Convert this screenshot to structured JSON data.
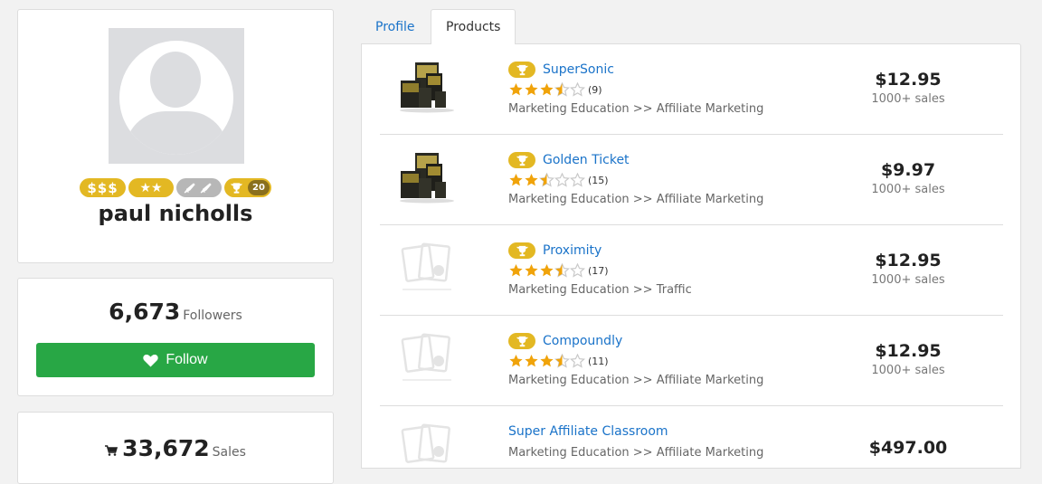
{
  "user": {
    "name": "paul nicholls",
    "badges": {
      "money": "$$$",
      "stars": "★★",
      "trophy_count": "20"
    }
  },
  "followers": {
    "count": "6,673",
    "label": "Followers",
    "button_label": "Follow"
  },
  "sales": {
    "count": "33,672",
    "label": "Sales"
  },
  "tabs": [
    {
      "label": "Profile"
    },
    {
      "label": "Products"
    }
  ],
  "products": [
    {
      "title": "SuperSonic",
      "rating": 3.5,
      "reviews": "(9)",
      "category": "Marketing Education >> Affiliate Marketing",
      "price": "$12.95",
      "sales": "1000+ sales",
      "badge": true,
      "image": "product-box"
    },
    {
      "title": "Golden Ticket",
      "rating": 2.5,
      "reviews": "(15)",
      "category": "Marketing Education >> Affiliate Marketing",
      "price": "$9.97",
      "sales": "1000+ sales",
      "badge": true,
      "image": "product-box"
    },
    {
      "title": "Proximity",
      "rating": 3.5,
      "reviews": "(17)",
      "category": "Marketing Education >> Traffic",
      "price": "$12.95",
      "sales": "1000+ sales",
      "badge": true,
      "image": "placeholder"
    },
    {
      "title": "Compoundly",
      "rating": 3.5,
      "reviews": "(11)",
      "category": "Marketing Education >> Affiliate Marketing",
      "price": "$12.95",
      "sales": "1000+ sales",
      "badge": true,
      "image": "placeholder"
    },
    {
      "title": "Super Affiliate Classroom",
      "rating": null,
      "reviews": "",
      "category": "Marketing Education >> Affiliate Marketing",
      "price": "$497.00",
      "sales": "",
      "badge": false,
      "image": "placeholder"
    }
  ],
  "colors": {
    "accent": "#1a73c9",
    "follow_green": "#28a745",
    "badge_gold": "#e3b823",
    "star": "#f0a30a"
  }
}
